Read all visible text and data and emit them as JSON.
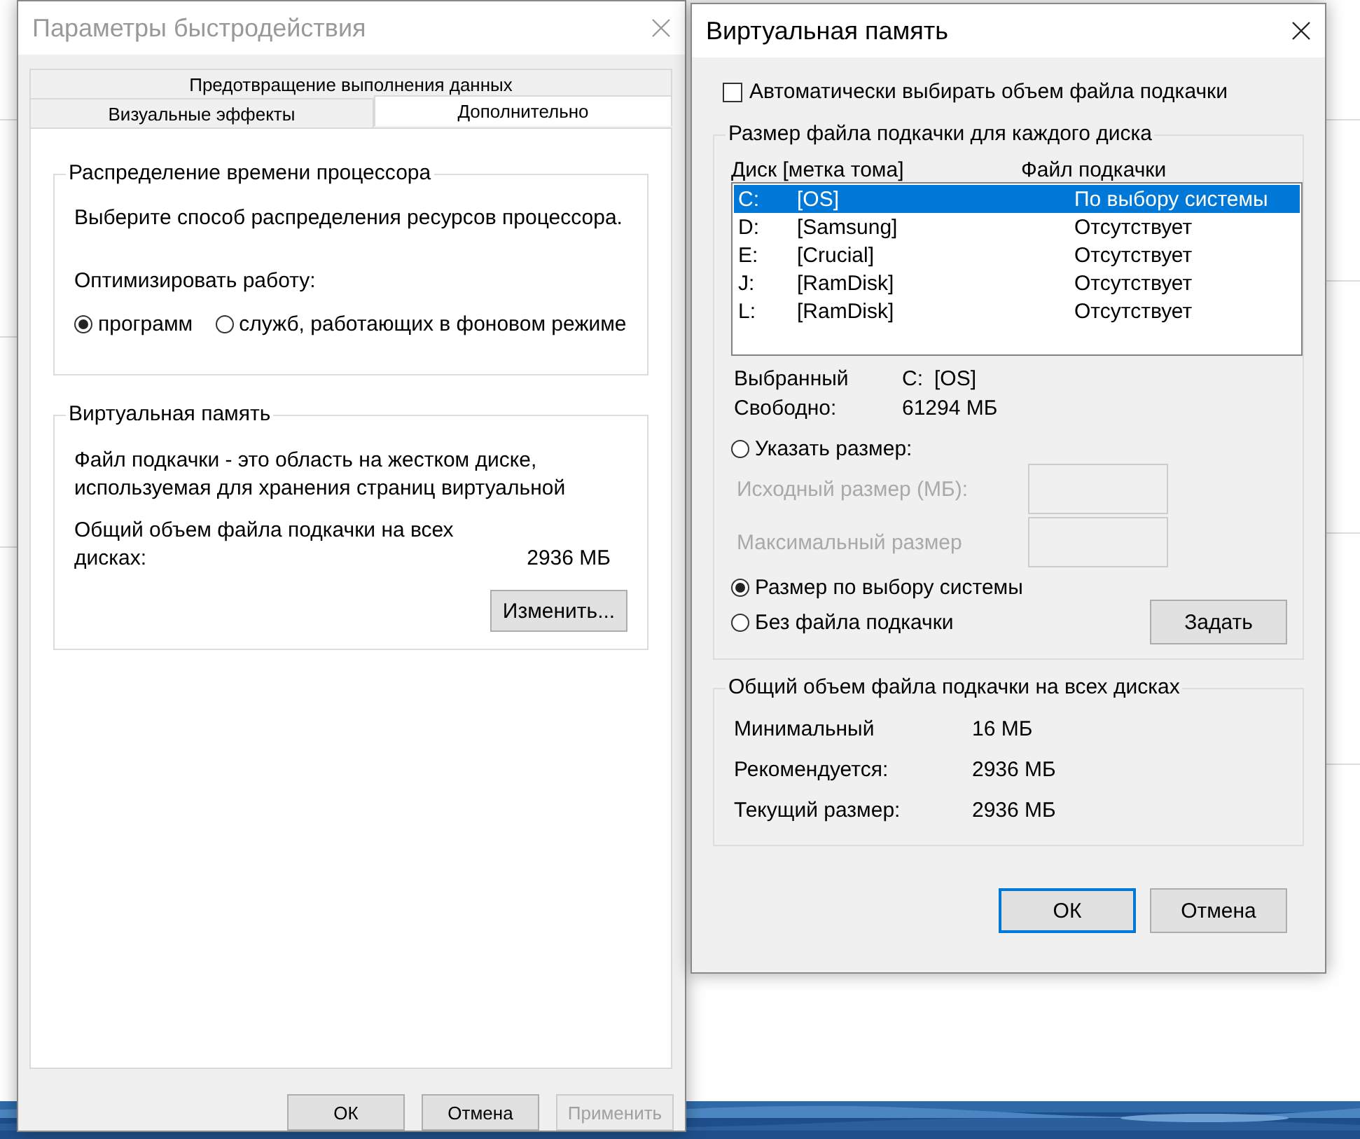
{
  "performance_dialog": {
    "title": "Параметры быстродействия",
    "tab_rows": [
      [
        {
          "label": "Предотвращение выполнения данных",
          "selected": false
        }
      ],
      [
        {
          "label": "Визуальные эффекты",
          "selected": false
        },
        {
          "label": "Дополнительно",
          "selected": true
        }
      ]
    ],
    "processor_group": {
      "title": "Распределение времени процессора",
      "description": "Выберите способ распределения ресурсов процессора.",
      "optimize_label": "Оптимизировать работу:",
      "options": [
        {
          "label": "программ",
          "selected": true
        },
        {
          "label": "служб, работающих в фоновом режиме",
          "selected": false
        }
      ]
    },
    "memory_group": {
      "title": "Виртуальная память",
      "description": "Файл подкачки - это область на жестком диске, используемая для хранения страниц виртуальной",
      "total_label": "Общий объем файла подкачки на всех дисках:",
      "total_value": "2936 МБ",
      "button": "Изменить..."
    },
    "buttons": [
      {
        "label": "ОК",
        "disabled": false
      },
      {
        "label": "Отмена",
        "disabled": false
      },
      {
        "label": "Применить",
        "disabled": true
      }
    ]
  },
  "virtual_memory_dialog": {
    "title": "Виртуальная память",
    "auto_checkbox": {
      "label": "Автоматически выбирать объем файла подкачки",
      "checked": false
    },
    "drives_group": {
      "title": "Размер файла подкачки для каждого диска",
      "columns": [
        "Диск [метка тома]",
        "Файл подкачки"
      ],
      "drives": [
        {
          "letter": "C:",
          "label": "[OS]",
          "paging_file": "По выбору системы",
          "selected": true
        },
        {
          "letter": "D:",
          "label": "[Samsung]",
          "paging_file": "Отсутствует",
          "selected": false
        },
        {
          "letter": "E:",
          "label": "[Crucial]",
          "paging_file": "Отсутствует",
          "selected": false
        },
        {
          "letter": "J:",
          "label": "[RamDisk]",
          "paging_file": "Отсутствует",
          "selected": false
        },
        {
          "letter": "L:",
          "label": "[RamDisk]",
          "paging_file": "Отсутствует",
          "selected": false
        }
      ],
      "selected_label": "Выбранный",
      "selected_letter": "C:",
      "selected_drive": "[OS]",
      "free_label": "Свободно:",
      "free_value": "61294 МБ",
      "size_options": [
        {
          "label": "Указать размер:",
          "selected": false
        },
        {
          "label": "Размер по выбору системы",
          "selected": true
        },
        {
          "label": "Без файла подкачки",
          "selected": false
        }
      ],
      "size_fields": [
        {
          "label": "Исходный размер (МБ):",
          "disabled": true
        },
        {
          "label": "Максимальный размер",
          "disabled": true
        }
      ],
      "set_button": "Задать"
    },
    "totals_group": {
      "title": "Общий объем файла подкачки на всех дисках",
      "rows": [
        {
          "label": "Минимальный",
          "value": "16 МБ"
        },
        {
          "label": "Рекомендуется:",
          "value": "2936 МБ"
        },
        {
          "label": "Текущий размер:",
          "value": "2936 МБ"
        }
      ]
    },
    "buttons": [
      {
        "label": "ОК",
        "default": true
      },
      {
        "label": "Отмена",
        "default": false
      }
    ]
  }
}
